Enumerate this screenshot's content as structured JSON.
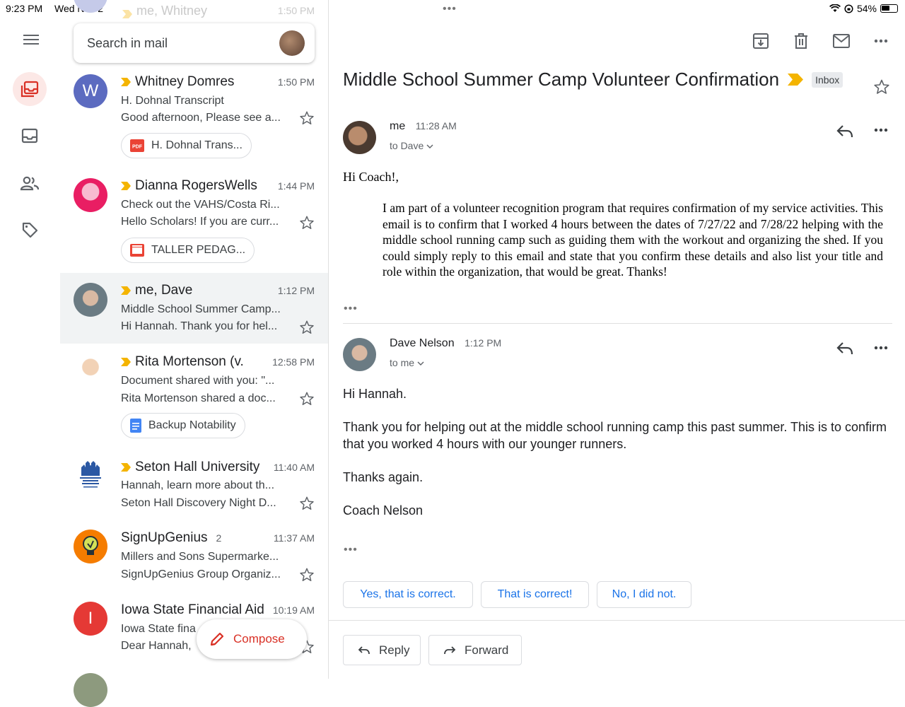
{
  "status_bar": {
    "time": "9:23 PM",
    "date": "Wed Nov 2",
    "battery": "54%"
  },
  "search": {
    "placeholder": "Search in mail"
  },
  "ghost_row": {
    "sender": "me, Whitney",
    "time": "1:50 PM"
  },
  "emails": [
    {
      "avatar_letter": "W",
      "avatar_color": "#5c6bc0",
      "sender": "Whitney Domres",
      "time": "1:50 PM",
      "subject": "H. Dohnal Transcript",
      "snippet": "Good afternoon, Please see a...",
      "attachment": "H. Dohnal Trans...",
      "attachment_icon": "pdf-icon"
    },
    {
      "avatar_letter": "",
      "avatar_color": "#e91e63",
      "sender": "Dianna RogersWells",
      "time": "1:44 PM",
      "subject": "Check out the VAHS/Costa Ri...",
      "snippet": "Hello Scholars! If you are curr...",
      "attachment": "TALLER PEDAG...",
      "attachment_icon": "slides-icon"
    },
    {
      "avatar_letter": "",
      "avatar_color": "#7b8a8f",
      "sender": "me, Dave",
      "time": "1:12 PM",
      "subject": "Middle School Summer Camp...",
      "snippet": "Hi Hannah. Thank you for hel..."
    },
    {
      "avatar_letter": "",
      "avatar_color": "#d9c7b3",
      "sender": "Rita Mortenson (v.",
      "time": "12:58 PM",
      "subject": "Document shared with you: \"...",
      "snippet": "Rita Mortenson shared a doc...",
      "attachment": "Backup Notability",
      "attachment_icon": "docs-icon"
    },
    {
      "avatar_letter": "",
      "avatar_color": "#ffffff",
      "sender": "Seton Hall University",
      "time": "11:40 AM",
      "subject": "Hannah, learn more about th...",
      "snippet": "Seton Hall Discovery Night D..."
    },
    {
      "avatar_letter": "",
      "avatar_color": "#f57c00",
      "sender": "SignUpGenius",
      "count": "2",
      "time": "11:37 AM",
      "subject": "Millers and Sons Supermarke...",
      "snippet": "SignUpGenius Group Organiz..."
    },
    {
      "avatar_letter": "I",
      "avatar_color": "#e53935",
      "sender": "Iowa State Financial Aid",
      "time": "10:19 AM",
      "subject": "Iowa State fina",
      "snippet": "Dear Hannah,"
    }
  ],
  "compose": {
    "label": "Compose"
  },
  "thread": {
    "subject": "Middle School Summer Camp Volunteer Confirmation",
    "label": "Inbox",
    "messages": [
      {
        "from": "me",
        "time": "11:28 AM",
        "to": "to Dave",
        "greeting": "Hi Coach!,",
        "body": "I am part of a volunteer recognition program that requires confirmation of my service activities. This email is to confirm that I worked 4 hours between the dates of 7/27/22 and 7/28/22 helping with the middle school running camp such as guiding them with the workout and organizing the shed. If you could simply reply to this email and state that you confirm these details and also list your title and role within the organization, that would be great. Thanks!"
      },
      {
        "from": "Dave Nelson",
        "time": "1:12 PM",
        "to": "to me",
        "greeting": "Hi Hannah.",
        "body": "Thank you for helping out at the middle school running camp this past summer.  This is to confirm that you worked 4 hours with our younger runners.",
        "thanks": "Thanks again.",
        "signature": "Coach Nelson"
      }
    ]
  },
  "smart_replies": [
    "Yes, that is correct.",
    "That is correct!",
    "No, I did not."
  ],
  "actions": {
    "reply": "Reply",
    "forward": "Forward"
  },
  "colors": {
    "accent_red": "#d93025",
    "link_blue": "#1a73e8",
    "important": "#f4b400",
    "selected_row": "#f1f3f4"
  }
}
